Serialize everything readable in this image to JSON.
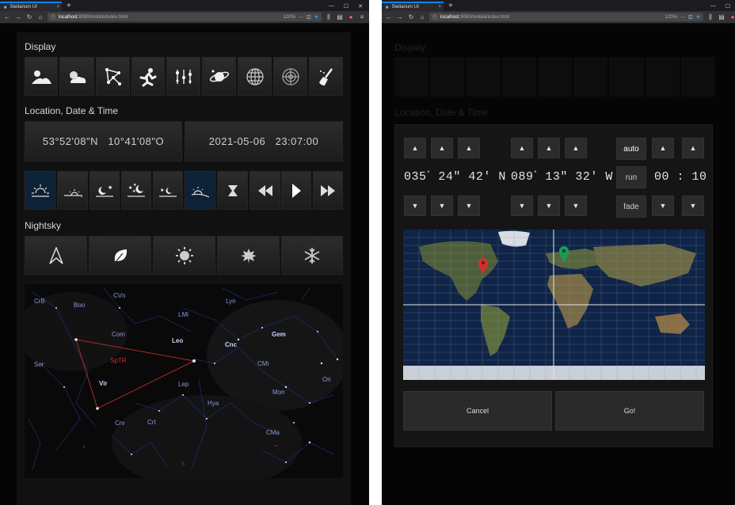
{
  "browser": {
    "tab_title": "Stellarium UI",
    "url_host": "localhost",
    "url_rest": ":8090/mobile/index.html",
    "zoom": "120%",
    "new_tab": "+",
    "tab_close": "×",
    "menu_dots": "···"
  },
  "left": {
    "display": {
      "heading": "Display",
      "buttons": [
        "landscape-icon",
        "atmosphere-icon",
        "constellation-lines-icon",
        "constellation-art-icon",
        "constellation-labels-icon",
        "planets-icon",
        "azimuthal-grid-icon",
        "equatorial-grid-icon",
        "clear-icon"
      ]
    },
    "location": {
      "heading": "Location, Date & Time",
      "latitude": "53°52'08\"N",
      "longitude": "10°41'08\"O",
      "date": "2021-05-06",
      "time": "23:07:00"
    },
    "time_buttons": [
      "sunrise-icon",
      "sunset-icon",
      "moonrise-icon",
      "night-icon",
      "dawn-icon",
      "day-icon",
      "hourglass-icon",
      "rewind-icon",
      "play-icon",
      "fast-forward-icon"
    ],
    "nightsky": {
      "heading": "Nightsky",
      "buttons": [
        "north-arrow-icon",
        "leaf-icon",
        "sun-icon",
        "maple-leaf-icon",
        "snowflake-icon"
      ]
    },
    "sky_labels": {
      "crb": "CrB",
      "boo": "Boo",
      "cvn": "CVn",
      "lyn": "Lyn",
      "lmi": "LMi",
      "com": "Com",
      "leo": "Leo",
      "cnc": "Cnc",
      "gem": "Gem",
      "ser": "Ser",
      "sptr": "SpTR",
      "cmi": "CMi",
      "vir": "Vir",
      "lep": "Lep",
      "ori": "Ori",
      "mon": "Mon",
      "hya": "Hya",
      "crv": "Crv",
      "crt": "Crt",
      "cma": "CMa",
      "e": "e",
      "s": "S",
      "se": "ꟹ"
    }
  },
  "right": {
    "display_heading": "Display",
    "location_heading": "Location, Date & Time",
    "arrow_up": "▲",
    "arrow_down": "▼",
    "latitude": {
      "deg": "035",
      "deg_mark": "°",
      "min": "24\"",
      "sec": "42'",
      "hemi": "N"
    },
    "longitude": {
      "deg": "089",
      "deg_mark": "°",
      "min": "13\"",
      "sec": "32'",
      "hemi": "W"
    },
    "auto_label": "auto",
    "run_label": "run",
    "fade_label": "fade",
    "timer": "00 : 10",
    "cancel_label": "Cancel",
    "go_label": "Go!"
  },
  "colors": {
    "accent_blue": "#0a84ff",
    "highlight_button": "#0d2236",
    "constellation_line": "#c03030",
    "pin_red": "#d0312d",
    "pin_green": "#1f9a55"
  }
}
